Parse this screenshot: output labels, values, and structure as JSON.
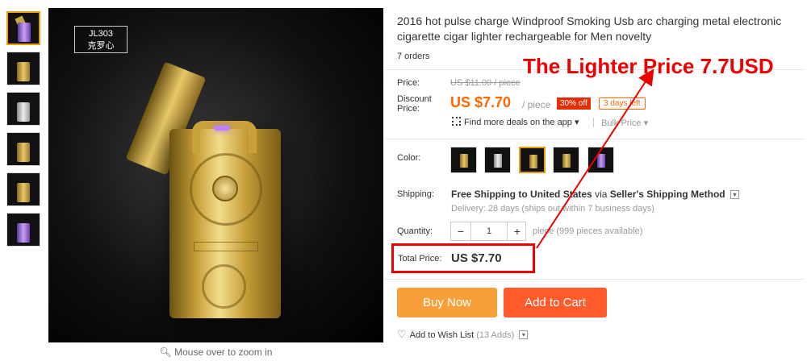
{
  "gallery": {
    "label_line1": "JL303",
    "label_line2": "克罗心",
    "zoom_hint": "Mouse over to zoom in"
  },
  "product": {
    "title": "2016 hot pulse charge Windproof Smoking Usb arc charging metal electronic cigarette cigar lighter rechargeable for Men novelty",
    "orders": "7 orders"
  },
  "price": {
    "price_label": "Price:",
    "old_price": "US $11.00 / piece",
    "discount_label_1": "Discount",
    "discount_label_2": "Price:",
    "new_price": "US $7.70",
    "per_unit": "/ piece",
    "off_badge": "30% off",
    "days_left": "3 days left",
    "app_deals": "Find more deals on the app",
    "bulk_price": "Bulk Price"
  },
  "color": {
    "label": "Color:"
  },
  "shipping": {
    "label": "Shipping:",
    "free": "Free Shipping",
    "to": "to",
    "country": "United States",
    "via": "via",
    "method": "Seller's Shipping Method",
    "delivery": "Delivery: 28 days (ships out within 7 business days)"
  },
  "quantity": {
    "label": "Quantity:",
    "value": "1",
    "minus": "−",
    "plus": "+",
    "available": "piece (999 pieces available)"
  },
  "total": {
    "label": "Total Price:",
    "value": "US $7.70"
  },
  "actions": {
    "buy_now": "Buy Now",
    "add_to_cart": "Add to Cart",
    "wish_list": "Add to Wish List",
    "wish_count": "(13 Adds)"
  },
  "annotation": {
    "text": "The Lighter Price 7.7USD",
    "color": "#e00000"
  }
}
